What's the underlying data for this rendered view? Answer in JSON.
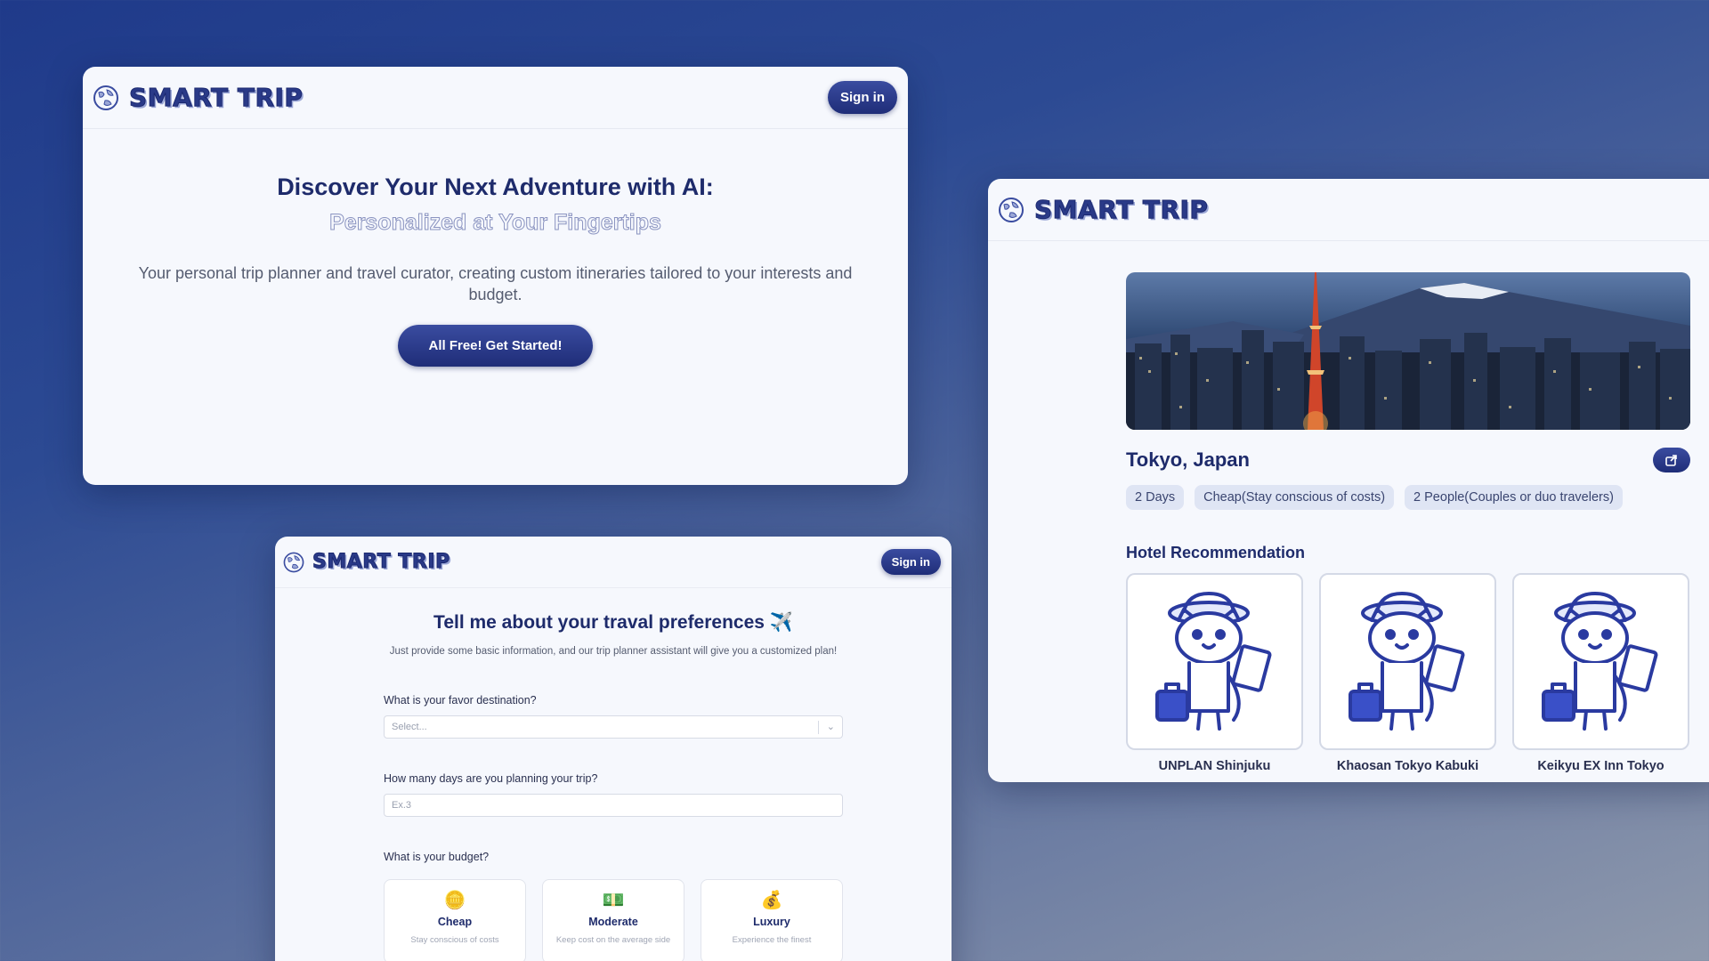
{
  "brand": {
    "name": "SMART TRIP"
  },
  "landing": {
    "signin_label": "Sign in",
    "headline": "Discover Your Next Adventure with AI:",
    "subheadline": "Personalized at Your Fingertips",
    "description": "Your personal trip planner and travel curator, creating custom itineraries tailored to your interests and budget.",
    "cta_label": "All Free! Get Started!"
  },
  "form": {
    "signin_label": "Sign in",
    "title": "Tell me about your traval preferences ✈️",
    "subtitle": "Just provide some basic information, and our trip planner assistant will give you a customized plan!",
    "destination_question": "What is your favor destination?",
    "destination_placeholder": "Select...",
    "days_question": "How many days are you planning your trip?",
    "days_placeholder": "Ex.3",
    "budget_question": "What is your budget?",
    "budget_options": [
      {
        "icon": "coin-icon",
        "glyph": "🪙",
        "name": "Cheap",
        "desc": "Stay conscious of costs"
      },
      {
        "icon": "cash-icon",
        "glyph": "💵",
        "name": "Moderate",
        "desc": "Keep cost on the average side"
      },
      {
        "icon": "money-bag-icon",
        "glyph": "💰",
        "name": "Luxury",
        "desc": "Experience the finest"
      }
    ]
  },
  "trip": {
    "title": "Tokyo, Japan",
    "tags": [
      "2 Days",
      "Cheap(Stay conscious of costs)",
      "2 People(Couples or duo travelers)"
    ],
    "hotel_section_title": "Hotel Recommendation",
    "hotels": [
      {
        "name": "UNPLAN Shinjuku"
      },
      {
        "name": "Khaosan Tokyo Kabuki"
      },
      {
        "name": "Keikyu EX Inn Tokyo"
      }
    ]
  },
  "colors": {
    "brand_dark": "#1e2b6b",
    "accent": "#2a3a88",
    "tag_bg": "#dfe5f4"
  }
}
